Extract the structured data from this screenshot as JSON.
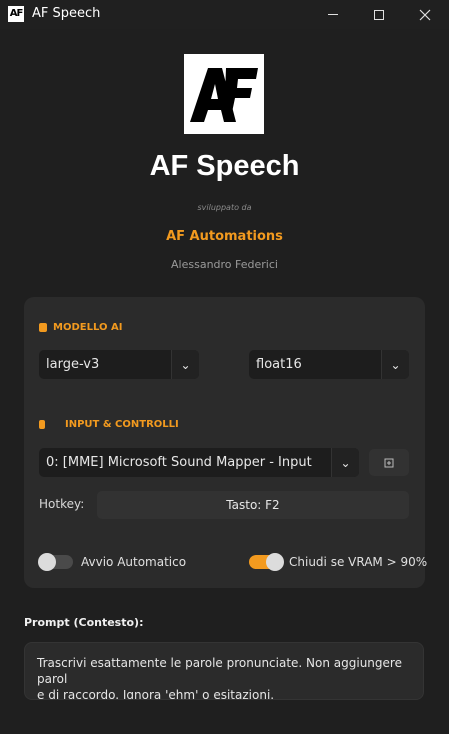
{
  "window": {
    "icon_text": "AF",
    "title": "AF Speech",
    "controls": [
      "minimize",
      "maximize",
      "close"
    ]
  },
  "header": {
    "logo_text": "AF",
    "title": "AF Speech",
    "developed_by": "sviluppato da",
    "company": "AF Automations",
    "author": "Alessandro Federici"
  },
  "model_section": {
    "label": "MODELLO AI",
    "model_select": {
      "value": "large-v3",
      "icon": "chevron-down-icon"
    },
    "precision_select": {
      "value": "float16",
      "icon": "chevron-down-icon"
    }
  },
  "input_section": {
    "label": "INPUT & CONTROLLI",
    "device_select": {
      "value": "0: [MME] Microsoft Sound Mapper - Input",
      "icon": "chevron-down-icon"
    },
    "refresh_icon": "refresh-icon",
    "hotkey_label": "Hotkey:",
    "hotkey_value": "Tasto: F2"
  },
  "toggles": {
    "auto_start": {
      "label": "Avvio Automatico",
      "checked": false
    },
    "close_vram": {
      "label": "Chiudi se VRAM > 90%",
      "checked": true
    }
  },
  "prompt": {
    "title": "Prompt (Contesto):",
    "text": "Trascrivi esattamente le parole pronunciate. Non aggiungere parol\ne di raccordo. Ignora 'ehm' o esitazioni."
  },
  "colors": {
    "accent": "#f29a1f",
    "background": "#1f1f1f",
    "card": "#2b2b2b"
  }
}
